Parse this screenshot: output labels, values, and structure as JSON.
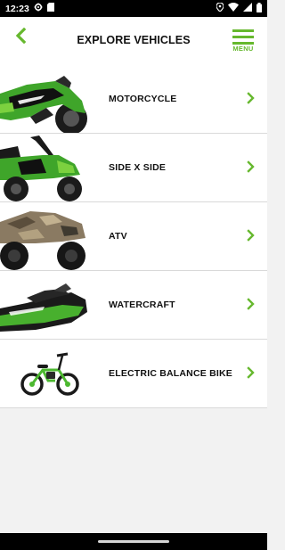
{
  "status_bar": {
    "time": "12:23",
    "icons": [
      "settings-gear-icon",
      "sd-card-icon",
      "location-icon",
      "wifi-icon",
      "signal-icon",
      "battery-icon"
    ]
  },
  "header": {
    "title": "EXPLORE VEHICLES",
    "back_icon": "chevron-left-icon",
    "menu_label": "MENU",
    "menu_icon": "hamburger-icon"
  },
  "vehicles": [
    {
      "label": "MOTORCYCLE",
      "image": "green-sport-motorcycle"
    },
    {
      "label": "SIDE X SIDE",
      "image": "green-side-by-side-utv"
    },
    {
      "label": "ATV",
      "image": "camo-atv"
    },
    {
      "label": "WATERCRAFT",
      "image": "green-jet-ski"
    },
    {
      "label": "ELECTRIC BALANCE BIKE",
      "image": "green-electric-balance-bike"
    }
  ],
  "colors": {
    "accent": "#66b82e",
    "header_bg": "#ffffff",
    "page_bg": "#f2f2f2",
    "text": "#111111"
  }
}
